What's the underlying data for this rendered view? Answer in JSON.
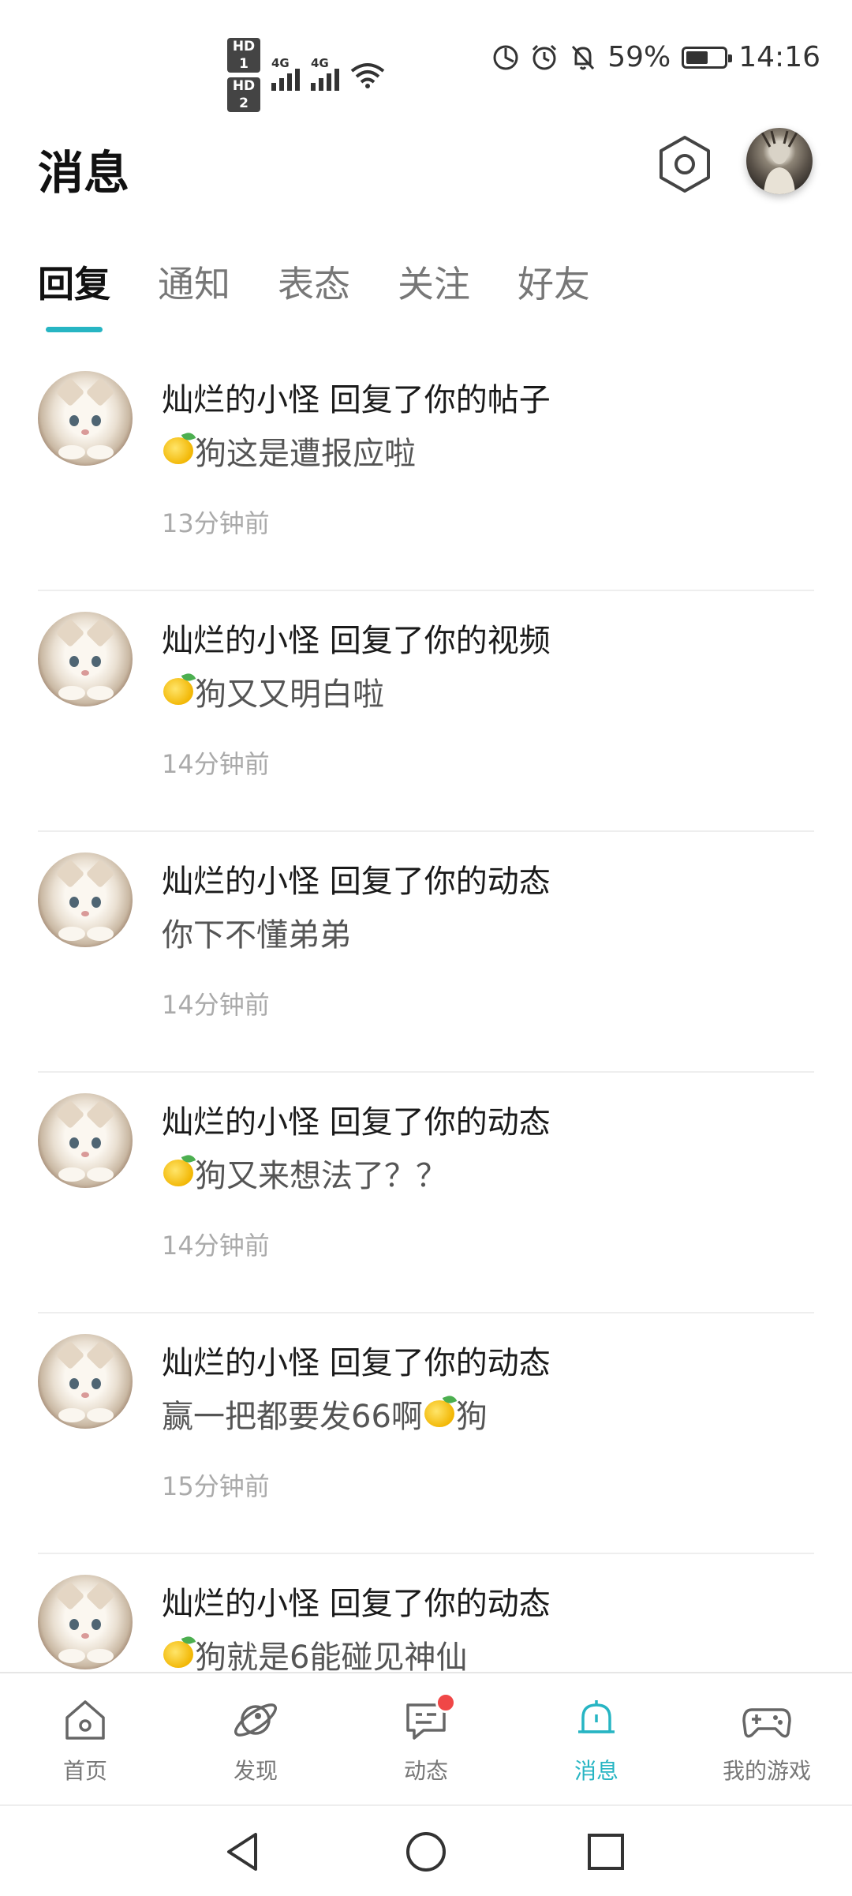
{
  "status_bar": {
    "sim1_label": "HD 1",
    "sim2_label": "HD 2",
    "network1": "4G",
    "network2": "4G",
    "battery_percent_text": "59%",
    "battery_level": 0.59,
    "time": "14:16"
  },
  "header": {
    "title": "消息"
  },
  "tabs": [
    {
      "label": "回复",
      "active": true
    },
    {
      "label": "通知",
      "active": false
    },
    {
      "label": "表态",
      "active": false
    },
    {
      "label": "关注",
      "active": false
    },
    {
      "label": "好友",
      "active": false
    }
  ],
  "messages": [
    {
      "title": "灿烂的小怪 回复了你的帖子",
      "content_before": "",
      "content_after": "狗这是遭报应啦",
      "lemon_position": "start",
      "time": "13分钟前"
    },
    {
      "title": "灿烂的小怪 回复了你的视频",
      "content_before": "",
      "content_after": "狗又又明白啦",
      "lemon_position": "start",
      "time": "14分钟前"
    },
    {
      "title": "灿烂的小怪 回复了你的动态",
      "content_before": "你下不懂弟弟",
      "content_after": "",
      "lemon_position": "none",
      "time": "14分钟前"
    },
    {
      "title": "灿烂的小怪 回复了你的动态",
      "content_before": "",
      "content_after": "狗又来想法了？？",
      "lemon_position": "start",
      "time": "14分钟前"
    },
    {
      "title": "灿烂的小怪 回复了你的动态",
      "content_before": "赢一把都要发66啊",
      "content_after": "狗",
      "lemon_position": "middle",
      "time": "15分钟前"
    },
    {
      "title": "灿烂的小怪 回复了你的动态",
      "content_before": "",
      "content_after": "狗就是6能碰见神仙",
      "lemon_position": "start",
      "time": ""
    }
  ],
  "bottom_nav": [
    {
      "label": "首页",
      "icon": "home-icon",
      "active": false
    },
    {
      "label": "发现",
      "icon": "planet-icon",
      "active": false
    },
    {
      "label": "动态",
      "icon": "chat-bubble-icon",
      "active": false,
      "badge": true
    },
    {
      "label": "消息",
      "icon": "bell-icon",
      "active": true
    },
    {
      "label": "我的游戏",
      "icon": "gamepad-icon",
      "active": false
    }
  ],
  "colors": {
    "accent": "#27b5c3",
    "badge": "#f04747",
    "text_primary": "#1a1a1a",
    "text_secondary": "#555555",
    "text_muted": "#aaaaaa"
  }
}
